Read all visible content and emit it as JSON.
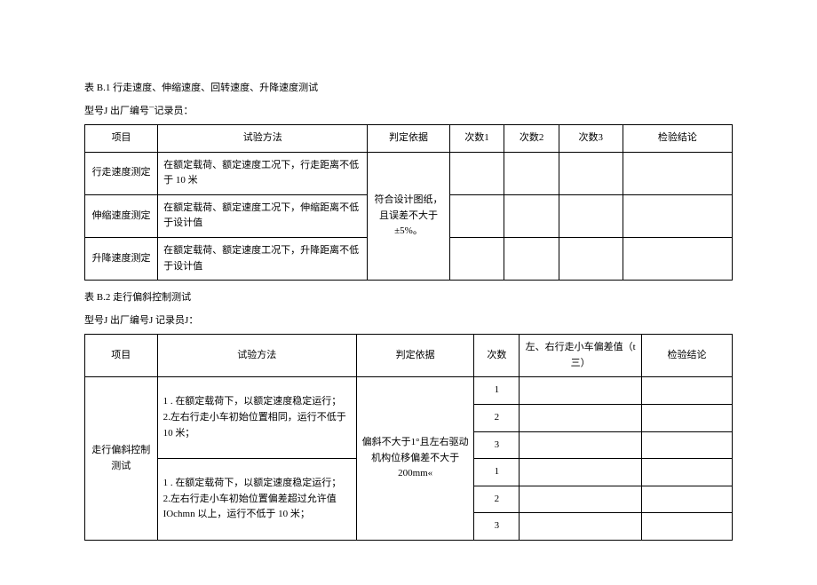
{
  "table1": {
    "title": "表 B.1 行走速度、伸缩速度、回转速度、升降速度测试",
    "subline": "型号J 出厂编号¯记录员：",
    "headers": {
      "item": "项目",
      "method": "试验方法",
      "basis": "判定依据",
      "n1": "次数1",
      "n2": "次数2",
      "n3": "次数3",
      "conclusion": "检验结论"
    },
    "rows": {
      "r1_item": "行走速度测定",
      "r1_method": "在额定载荷、额定速度工况下，行走距离不低于 10 米",
      "r2_item": "伸缩速度测定",
      "r2_method": "在额定载荷、额定速度工况下，伸缩距离不低于设计值",
      "r3_item": "升降速度测定",
      "r3_method": "在额定载荷、额定速度工况下，升降距离不低于设计值",
      "basis": "符合设计图纸，且误差不大于 ±5%。"
    }
  },
  "table2": {
    "title": "表 B.2 走行偏斜控制测试",
    "subline": "型号J 出厂编号J 记录员J：",
    "headers": {
      "item": "项目",
      "method": "试验方法",
      "basis": "判定依据",
      "count": "次数",
      "dev": "左、右行走小车偏差值（t 三）",
      "conclusion": "检验结论"
    },
    "rows": {
      "item": "走行偏斜控制测试",
      "method1": "1    . 在额定载荷下，以额定速度稳定运行；\n2.左右行走小车初始位置相同，运行不低于 10 米；",
      "method2": "1    . 在额定载荷下，以额定速度稳定运行；\n2.左右行走小车初始位置偏差超过允许值 IOchmn 以上，运行不低于 10 米；",
      "basis": "偏斜不大于1°且左右驱动机构位移偏差不大于 200mm«",
      "n1": "1",
      "n2": "2",
      "n3": "3",
      "n4": "1",
      "n5": "2",
      "n6": "3"
    }
  }
}
